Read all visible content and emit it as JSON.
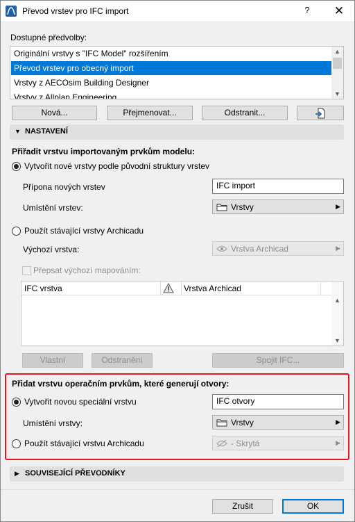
{
  "window": {
    "title": "Převod vrstev pro IFC import",
    "help": "?",
    "close": "✕"
  },
  "presets": {
    "label": "Dostupné předvolby:",
    "items": [
      "Originální vrstvy s \"IFC Model\" rozšířením",
      "Převod vrstev pro obecný import",
      "Vrstvy z AECOsim Building Designer",
      "Vrstvy z Allplan Engineering"
    ],
    "selected_index": 1,
    "buttons": {
      "new": "Nová...",
      "rename": "Přejmenovat...",
      "delete": "Odstranit..."
    }
  },
  "settings": {
    "header": "NASTAVENÍ",
    "assign_label": "Přiřadit vrstvu importovaným prvkům modelu:",
    "radio_new": "Vytvořit nové vrstvy podle původní struktury vrstev",
    "suffix_label": "Přípona nových vrstev",
    "suffix_value": "IFC import",
    "placement_label": "Umístění vrstev:",
    "placement_value": "Vrstvy",
    "radio_existing": "Použít stávající vrstvy Archicadu",
    "default_layer_label": "Výchozí vrstva:",
    "default_layer_value": "Vrstva Archicad",
    "override_label": "Přepsat výchozí mapováním:",
    "table": {
      "col_ifc": "IFC vrstva",
      "col_archicad": "Vrstva Archicad"
    },
    "buttons": {
      "custom": "Vlastní",
      "remove": "Odstranění",
      "merge": "Spojit IFC..."
    }
  },
  "openings": {
    "label": "Přidat vrstvu operačním prvkům, které generují otvory:",
    "radio_new": "Vytvořit novou speciální vrstvu",
    "layer_name": "IFC otvory",
    "placement_label": "Umístění vrstvy:",
    "placement_value": "Vrstvy",
    "radio_existing": "Použít stávající vrstvu Archicadu",
    "hidden_value": "- Skrytá"
  },
  "related": {
    "header": "SOUVISEJÍCÍ PŘEVODNÍKY"
  },
  "footer": {
    "cancel": "Zrušit",
    "ok": "OK"
  }
}
